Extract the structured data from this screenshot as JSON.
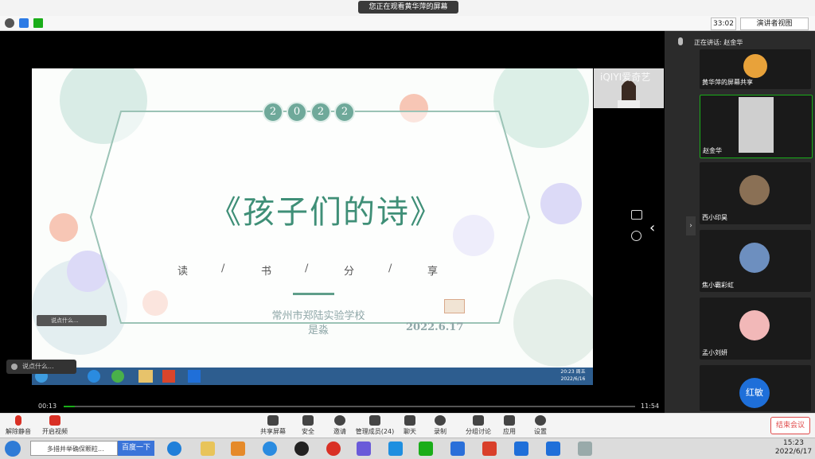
{
  "top": {
    "sharing_banner": "您正在观看黄华萍的屏幕",
    "timer": "33:02",
    "view_button": "演讲者视图"
  },
  "slide": {
    "year_digits": [
      "2",
      "0",
      "2",
      "2"
    ],
    "title": "《孩子们的诗》",
    "share_chars": [
      "读",
      "/",
      "书",
      "/",
      "分",
      "/",
      "享"
    ],
    "school": "常州市郑陆实验学校",
    "teacher": "是淼",
    "date": "2022.6.17",
    "inner_chat": "说点什么...",
    "inner_clock_time": "20:23 周五",
    "inner_clock_date": "2022/6/16"
  },
  "camera": {
    "watermark": "iQIYI爱奇艺"
  },
  "chat": {
    "placeholder": "说点什么..."
  },
  "playback": {
    "elapsed": "00:13",
    "total": "11:54",
    "progress": 0.02
  },
  "panel": {
    "speaking": "正在讲话: 赵金华",
    "participants": [
      {
        "name": "黄华萍的屏幕共享",
        "avatar_color": "#e8a23a"
      },
      {
        "name": "赵金华",
        "avatar_color": "#cfcfcf"
      },
      {
        "name": "西小印昊",
        "avatar_color": "#8a7055"
      },
      {
        "name": "焦小霸彩虹",
        "avatar_color": "#6d8fbf"
      },
      {
        "name": "孟小刘妍",
        "avatar_color": "#f2b8b8"
      },
      {
        "name": "红敏",
        "avatar_color": "#1e6fd9"
      }
    ]
  },
  "toolbar": {
    "mute": "解除静音",
    "video": "开启视频",
    "share": "共享屏幕",
    "security": "安全",
    "invite": "邀请",
    "members": "管理成员(24)",
    "chat": "聊天",
    "record": "录制",
    "breakout": "分组讨论",
    "apps": "应用",
    "settings": "设置",
    "end": "结束会议"
  },
  "taskbar": {
    "search_placeholder": "多措并举确保颗粒...",
    "search_button": "百度一下",
    "time": "15:23",
    "date": "2022/6/17"
  }
}
